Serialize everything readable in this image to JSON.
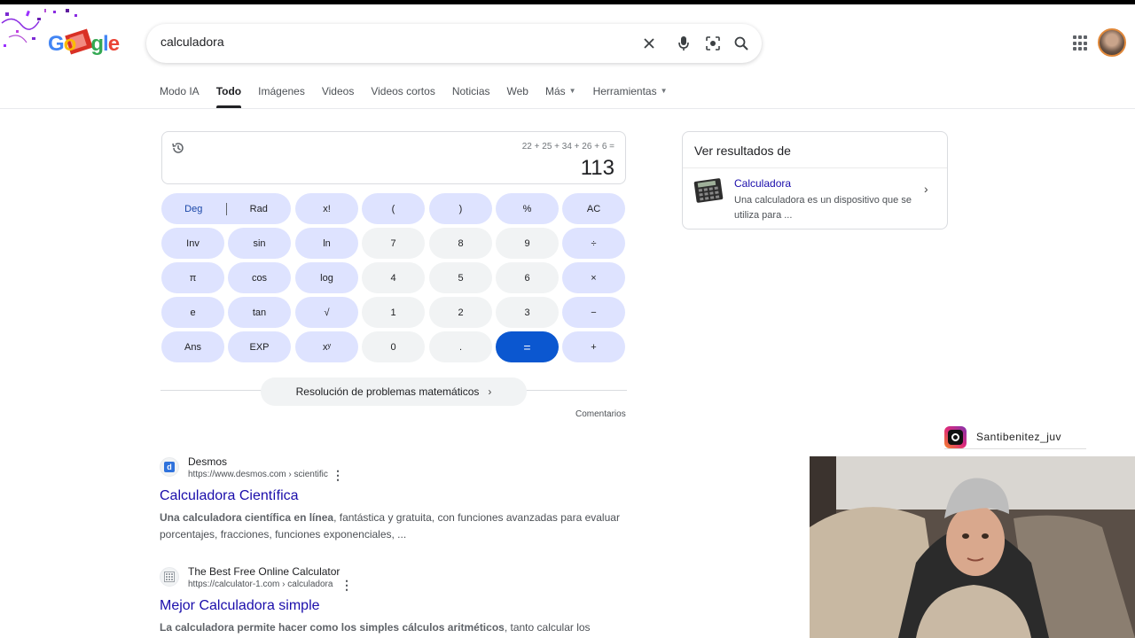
{
  "logo": {
    "text": "Google",
    "colors": [
      "#4285f4",
      "#ea4335",
      "#fbbc05",
      "#4285f4",
      "#34a853",
      "#ea4335"
    ]
  },
  "search": {
    "query": "calculadora",
    "icons": [
      "close-icon",
      "microphone-icon",
      "lens-icon",
      "search-icon"
    ]
  },
  "tabs": [
    {
      "label": "Modo IA"
    },
    {
      "label": "Todo",
      "active": true
    },
    {
      "label": "Imágenes"
    },
    {
      "label": "Videos"
    },
    {
      "label": "Videos cortos"
    },
    {
      "label": "Noticias"
    },
    {
      "label": "Web"
    },
    {
      "label": "Más",
      "dropdown": true
    },
    {
      "label": "Herramientas",
      "dropdown": true
    }
  ],
  "calculator": {
    "expression": "22 + 25 + 34 + 26 + 6 =",
    "result": "113",
    "keys": {
      "deg": "Deg",
      "rad": "Rad",
      "fact": "x!",
      "lparen": "(",
      "rparen": ")",
      "percent": "%",
      "ac": "AC",
      "inv": "Inv",
      "sin": "sin",
      "ln": "ln",
      "k7": "7",
      "k8": "8",
      "k9": "9",
      "div": "÷",
      "pi": "π",
      "cos": "cos",
      "log": "log",
      "k4": "4",
      "k5": "5",
      "k6": "6",
      "mul": "×",
      "e": "e",
      "tan": "tan",
      "sqrt": "√",
      "k1": "1",
      "k2": "2",
      "k3": "3",
      "sub": "−",
      "ans": "Ans",
      "exp": "EXP",
      "pow": "xʸ",
      "k0": "0",
      "dot": ".",
      "eq": "=",
      "add": "+"
    },
    "math_chip": "Resolución de problemas matemáticos",
    "comments": "Comentarios"
  },
  "results": [
    {
      "site": "Desmos",
      "url": "https://www.desmos.com › scientific",
      "title": "Calculadora Científica",
      "snippet_bold": "Una calculadora científica en línea",
      "snippet_rest": ", fantástica y gratuita, con funciones avanzadas para evaluar porcentajes, fracciones, funciones exponenciales, ..."
    },
    {
      "site": "The Best Free Online Calculator",
      "url": "https://calculator-1.com › calculadora",
      "title": "Mejor Calculadora simple",
      "snippet_bold": "La calculadora permite hacer como los simples cálculos aritméticos",
      "snippet_rest": ", tanto calcular los porcentajes,"
    }
  ],
  "knowledge_card": {
    "header": "Ver resultados de",
    "name": "Calculadora",
    "description": "Una calculadora es un dispositivo que se utiliza para ..."
  },
  "overlay": {
    "instagram_handle": "Santibenitez_juv"
  }
}
